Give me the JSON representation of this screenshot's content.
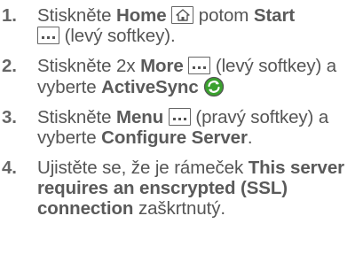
{
  "steps": [
    {
      "number": "1.",
      "t1": "Stiskněte ",
      "b1": "Home",
      "icon1": "home-key-icon",
      "t2": " potom ",
      "b2": "Start",
      "icon2": "softkey-dots-icon",
      "t3": " (levý softkey)."
    },
    {
      "number": "2.",
      "t1": "Stiskněte 2x ",
      "b1": "More",
      "icon1": "softkey-dots-icon",
      "t2": " (levý softkey) a vyberte ",
      "b2": "ActiveSync",
      "icon2": "activesync-icon",
      "t3": ""
    },
    {
      "number": "3.",
      "t1": "Stiskněte ",
      "b1": "Menu",
      "icon1": "softkey-dots-icon",
      "t2": " (pravý softkey) a vyberte ",
      "b2": "Configure Server",
      "t3": "."
    },
    {
      "number": "4.",
      "t1": "Ujistěte se, že je rámeček ",
      "b1": "This server requires an enscrypted (SSL) connection",
      "t2": " zaškrtnutý."
    }
  ],
  "colors": {
    "text": "#555555",
    "activesync_green": "#3aa12e",
    "activesync_outline": "#555555"
  }
}
